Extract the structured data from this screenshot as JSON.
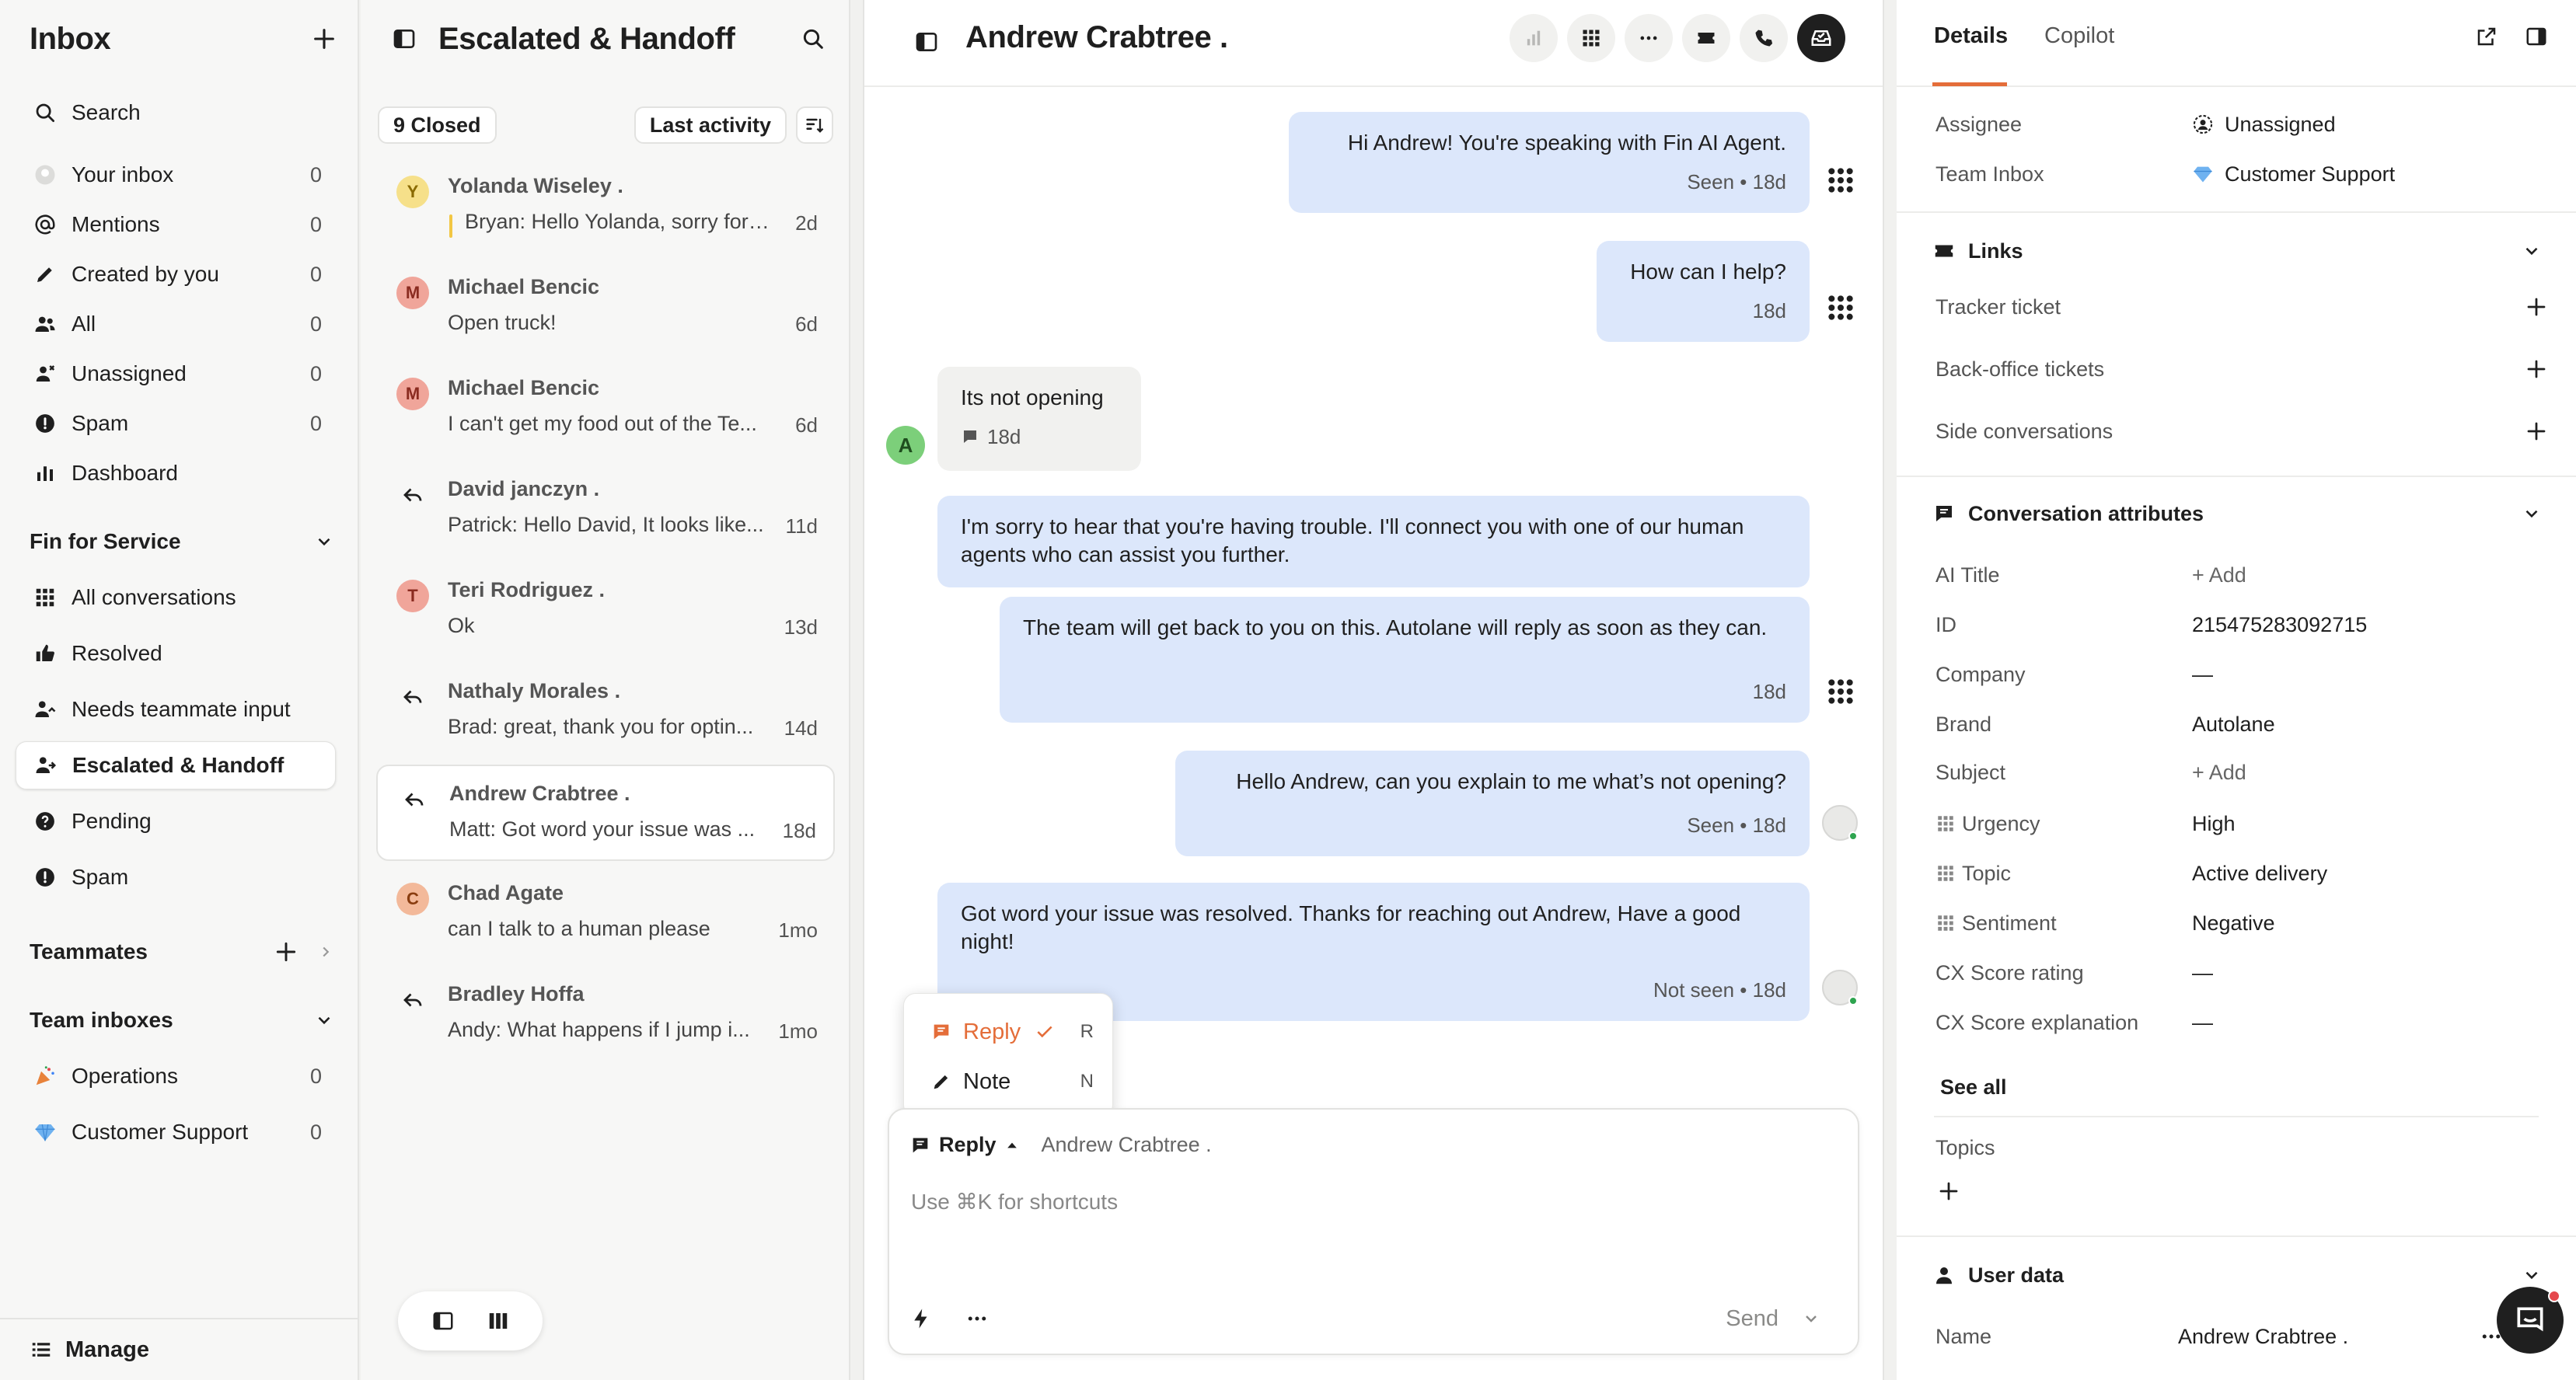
{
  "nav": {
    "title": "Inbox",
    "search": "Search",
    "items": [
      {
        "label": "Your inbox",
        "count": "0"
      },
      {
        "label": "Mentions",
        "count": "0"
      },
      {
        "label": "Created by you",
        "count": "0"
      },
      {
        "label": "All",
        "count": "0"
      },
      {
        "label": "Unassigned",
        "count": "0"
      },
      {
        "label": "Spam",
        "count": "0"
      },
      {
        "label": "Dashboard",
        "count": ""
      }
    ],
    "fin_section": "Fin for Service",
    "fin_items": [
      {
        "label": "All conversations"
      },
      {
        "label": "Resolved"
      },
      {
        "label": "Needs teammate input"
      },
      {
        "label": "Escalated & Handoff"
      },
      {
        "label": "Pending"
      },
      {
        "label": "Spam"
      }
    ],
    "teammates": "Teammates",
    "team_inboxes": "Team inboxes",
    "team_items": [
      {
        "label": "Operations",
        "count": "0"
      },
      {
        "label": "Customer Support",
        "count": "0"
      }
    ],
    "manage": "Manage"
  },
  "list": {
    "title": "Escalated & Handoff",
    "status_filter": "9 Closed",
    "sort": "Last activity",
    "conversations": [
      {
        "initial": "Y",
        "name": "Yolanda Wiseley .",
        "preview": "Bryan: Hello Yolanda, sorry for the delay",
        "time": "2d"
      },
      {
        "initial": "M",
        "name": "Michael Bencic",
        "preview": "Open truck!",
        "time": "6d"
      },
      {
        "initial": "M",
        "name": "Michael Bencic",
        "preview": "I can't get my food out of the Te...",
        "time": "6d"
      },
      {
        "initial": "",
        "name": "David janczyn .",
        "preview": "Patrick: Hello David, It looks like...",
        "time": "11d"
      },
      {
        "initial": "T",
        "name": "Teri Rodriguez .",
        "preview": "Ok",
        "time": "13d"
      },
      {
        "initial": "",
        "name": "Nathaly Morales .",
        "preview": "Brad: great, thank you for optin...",
        "time": "14d"
      },
      {
        "initial": "",
        "name": "Andrew Crabtree .",
        "preview": "Matt: Got word your issue was ...",
        "time": "18d"
      },
      {
        "initial": "C",
        "name": "Chad Agate",
        "preview": "can I talk to a human please",
        "time": "1mo"
      },
      {
        "initial": "",
        "name": "Bradley Hoffa",
        "preview": "Andy: What happens if I jump i...",
        "time": "1mo"
      }
    ]
  },
  "chat": {
    "title": "Andrew Crabtree .",
    "messages": [
      {
        "text": "Hi Andrew! You're speaking with Fin AI Agent.",
        "meta": "Seen • 18d"
      },
      {
        "text": "How can I help?",
        "meta": "18d"
      },
      {
        "text": "Its not opening",
        "meta": "18d"
      },
      {
        "text": "I'm sorry to hear that you're having trouble. I'll connect you with one of our human agents who can assist you further.",
        "meta": ""
      },
      {
        "text": "The team will get back to you on this. Autolane will reply as soon as they can.",
        "meta": "18d"
      },
      {
        "text": "Hello Andrew, can you explain to me what’s not opening?",
        "meta": "Seen • 18d"
      },
      {
        "text": "Got word your issue was resolved. Thanks for reaching out Andrew, Have a good night!",
        "meta": "Not seen • 18d"
      }
    ],
    "menu": [
      {
        "label": "Reply",
        "key": "R"
      },
      {
        "label": "Note",
        "key": "N"
      }
    ],
    "composer": {
      "mode": "Reply",
      "recipient": "Andrew Crabtree .",
      "placeholder": "Use ⌘K for shortcuts",
      "send": "Send"
    }
  },
  "details": {
    "tabs": [
      "Details",
      "Copilot"
    ],
    "assignee_label": "Assignee",
    "assignee_value": "Unassigned",
    "team_label": "Team Inbox",
    "team_value": "Customer Support",
    "links_title": "Links",
    "links": [
      "Tracker ticket",
      "Back-office tickets",
      "Side conversations"
    ],
    "attrs_title": "Conversation attributes",
    "attrs": [
      {
        "k": "AI Title",
        "v": "+ Add"
      },
      {
        "k": "ID",
        "v": "215475283092715"
      },
      {
        "k": "Company",
        "v": "—"
      },
      {
        "k": "Brand",
        "v": "Autolane"
      },
      {
        "k": "Subject",
        "v": "+ Add"
      },
      {
        "k": "Urgency",
        "v": "High"
      },
      {
        "k": "Topic",
        "v": "Active delivery"
      },
      {
        "k": "Sentiment",
        "v": "Negative"
      },
      {
        "k": "CX Score rating",
        "v": "—"
      },
      {
        "k": "CX Score explanation",
        "v": "—"
      }
    ],
    "see_all": "See all",
    "topics": "Topics",
    "user_data": "User data",
    "name_label": "Name",
    "name_value": "Andrew Crabtree ."
  },
  "colors": {
    "accent": "#e46d39",
    "bubble_out": "#dce7fb",
    "avatar_yellow": "#f6e08a",
    "avatar_red": "#f0a59a",
    "avatar_green": "#7ccf7a"
  }
}
